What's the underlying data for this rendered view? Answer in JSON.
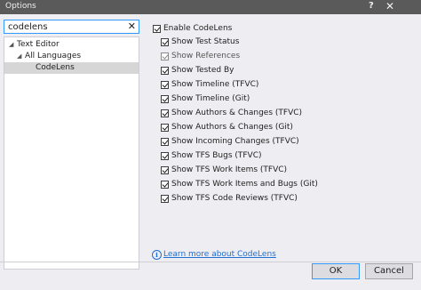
{
  "window": {
    "title": "Options",
    "help_glyph": "?",
    "close_glyph": "✕"
  },
  "search": {
    "value": "codelens",
    "clear_glyph": "✕"
  },
  "tree": [
    {
      "label": "Text Editor",
      "expander": "◢",
      "level": 0,
      "selected": false
    },
    {
      "label": "All Languages",
      "expander": "◢",
      "level": 1,
      "selected": false
    },
    {
      "label": "CodeLens",
      "expander": "",
      "level": 2,
      "selected": true
    }
  ],
  "enable": {
    "label": "Enable CodeLens",
    "checked": true
  },
  "options": [
    {
      "label": "Show Test Status",
      "checked": true,
      "enabled": true
    },
    {
      "label": "Show References",
      "checked": true,
      "enabled": false
    },
    {
      "label": "Show Tested By",
      "checked": true,
      "enabled": true
    },
    {
      "label": "Show Timeline (TFVC)",
      "checked": true,
      "enabled": true
    },
    {
      "label": "Show Timeline (Git)",
      "checked": true,
      "enabled": true
    },
    {
      "label": "Show Authors & Changes (TFVC)",
      "checked": true,
      "enabled": true
    },
    {
      "label": "Show Authors & Changes (Git)",
      "checked": true,
      "enabled": true
    },
    {
      "label": "Show Incoming Changes (TFVC)",
      "checked": true,
      "enabled": true
    },
    {
      "label": "Show TFS Bugs (TFVC)",
      "checked": true,
      "enabled": true
    },
    {
      "label": "Show TFS Work Items (TFVC)",
      "checked": true,
      "enabled": true
    },
    {
      "label": "Show TFS Work Items and Bugs (Git)",
      "checked": true,
      "enabled": true
    },
    {
      "label": "Show TFS Code Reviews (TFVC)",
      "checked": true,
      "enabled": true
    }
  ],
  "learn_more": {
    "label": "Learn more about CodeLens",
    "icon": "info-icon"
  },
  "buttons": {
    "ok": "OK",
    "cancel": "Cancel"
  },
  "colors": {
    "titlebar": "#5a5a5a",
    "accent": "#3399ff",
    "link": "#1e6fd1",
    "background": "#eeeef2"
  }
}
